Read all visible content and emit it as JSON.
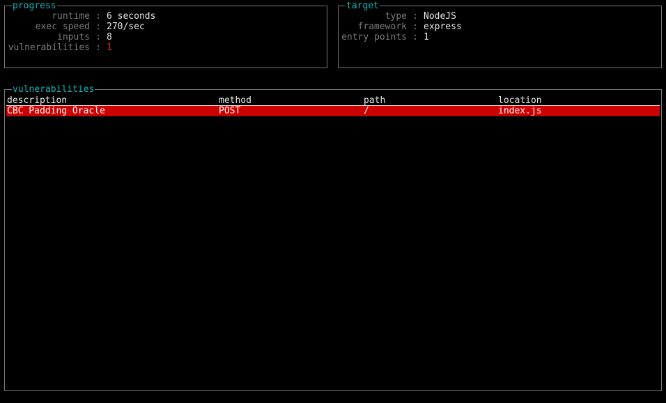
{
  "progress": {
    "title": "progress",
    "items": [
      {
        "label": "runtime",
        "value": "6 seconds",
        "alert": false
      },
      {
        "label": "exec speed",
        "value": "270/sec",
        "alert": false
      },
      {
        "label": "inputs",
        "value": "8",
        "alert": false
      },
      {
        "label": "vulnerabilities",
        "value": "1",
        "alert": true
      }
    ]
  },
  "target": {
    "title": "target",
    "items": [
      {
        "label": "type",
        "value": "NodeJS"
      },
      {
        "label": "framework",
        "value": "express"
      },
      {
        "label": "entry points",
        "value": "1"
      }
    ]
  },
  "vulnerabilities": {
    "title": "vulnerabilities",
    "columns": [
      "description",
      "method",
      "path",
      "location"
    ],
    "rows": [
      {
        "description": "CBC Padding Oracle",
        "method": "POST",
        "path": "/",
        "location": "index.js"
      }
    ]
  },
  "separator": ":",
  "colors": {
    "title": "#17b3b3",
    "label": "#7a7a7a",
    "value": "#e6e6e6",
    "alert": "#d42020",
    "selected_row": "#cc0000"
  }
}
